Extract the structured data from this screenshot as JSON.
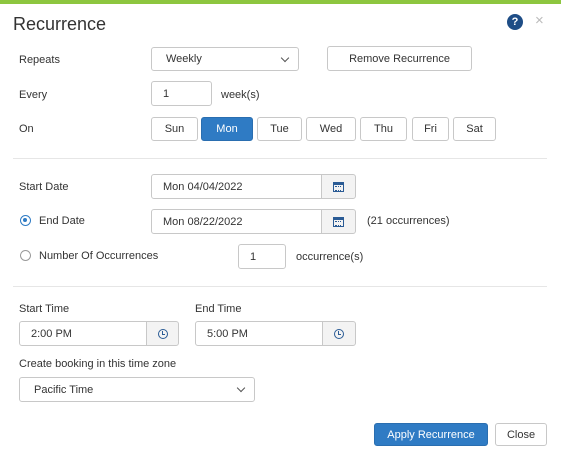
{
  "dialog": {
    "title": "Recurrence",
    "help_icon": "question-circle-icon",
    "close_icon": "close-icon",
    "accent_color": "#8dc63f",
    "primary_color": "#2f7bc4"
  },
  "repeats": {
    "label": "Repeats",
    "value": "Weekly",
    "remove_label": "Remove Recurrence"
  },
  "every": {
    "label": "Every",
    "value": "1",
    "unit": "week(s)"
  },
  "on": {
    "label": "On",
    "days": [
      "Sun",
      "Mon",
      "Tue",
      "Wed",
      "Thu",
      "Fri",
      "Sat"
    ],
    "selected": "Mon"
  },
  "start_date": {
    "label": "Start Date",
    "value": "Mon 04/04/2022",
    "icon": "calendar-icon"
  },
  "end_date": {
    "label": "End Date",
    "value": "Mon 08/22/2022",
    "icon": "calendar-icon",
    "note": "(21 occurrences)",
    "checked": true
  },
  "occurrences": {
    "label": "Number Of Occurrences",
    "value": "1",
    "unit": "occurrence(s)",
    "checked": false
  },
  "start_time": {
    "label": "Start Time",
    "value": "2:00 PM",
    "icon": "clock-icon"
  },
  "end_time": {
    "label": "End Time",
    "value": "5:00 PM",
    "icon": "clock-icon"
  },
  "timezone": {
    "label": "Create booking in this time zone",
    "value": "Pacific Time"
  },
  "footer": {
    "apply_label": "Apply Recurrence",
    "close_label": "Close"
  }
}
